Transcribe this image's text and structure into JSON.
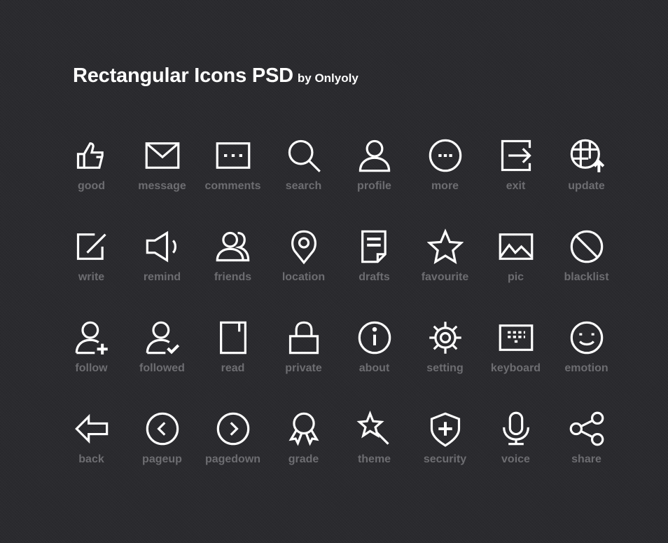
{
  "title": {
    "main": "Rectangular Icons PSD",
    "byline": "by Onlyoly"
  },
  "colors": {
    "background": "#2a2a2e",
    "icon": "#ffffff",
    "label": "#6d6d71",
    "title": "#ffffff"
  },
  "icons": [
    {
      "id": "good",
      "label": "good",
      "icon": "thumbs-up-icon"
    },
    {
      "id": "message",
      "label": "message",
      "icon": "envelope-icon"
    },
    {
      "id": "comments",
      "label": "comments",
      "icon": "comment-box-icon"
    },
    {
      "id": "search",
      "label": "search",
      "icon": "magnifier-icon"
    },
    {
      "id": "profile",
      "label": "profile",
      "icon": "user-icon"
    },
    {
      "id": "more",
      "label": "more",
      "icon": "ellipsis-circle-icon"
    },
    {
      "id": "exit",
      "label": "exit",
      "icon": "exit-arrow-icon"
    },
    {
      "id": "update",
      "label": "update",
      "icon": "globe-upload-icon"
    },
    {
      "id": "write",
      "label": "write",
      "icon": "edit-pencil-icon"
    },
    {
      "id": "remind",
      "label": "remind",
      "icon": "speaker-icon"
    },
    {
      "id": "friends",
      "label": "friends",
      "icon": "users-icon"
    },
    {
      "id": "location",
      "label": "location",
      "icon": "map-pin-icon"
    },
    {
      "id": "drafts",
      "label": "drafts",
      "icon": "document-icon"
    },
    {
      "id": "favourite",
      "label": "favourite",
      "icon": "star-icon"
    },
    {
      "id": "pic",
      "label": "pic",
      "icon": "image-icon"
    },
    {
      "id": "blacklist",
      "label": "blacklist",
      "icon": "block-icon"
    },
    {
      "id": "follow",
      "label": "follow",
      "icon": "user-add-icon"
    },
    {
      "id": "followed",
      "label": "followed",
      "icon": "user-check-icon"
    },
    {
      "id": "read",
      "label": "read",
      "icon": "book-icon"
    },
    {
      "id": "private",
      "label": "private",
      "icon": "lock-icon"
    },
    {
      "id": "about",
      "label": "about",
      "icon": "info-icon"
    },
    {
      "id": "setting",
      "label": "setting",
      "icon": "gear-icon"
    },
    {
      "id": "keyboard",
      "label": "keyboard",
      "icon": "keyboard-icon"
    },
    {
      "id": "emotion",
      "label": "emotion",
      "icon": "smiley-icon"
    },
    {
      "id": "back",
      "label": "back",
      "icon": "arrow-left-icon"
    },
    {
      "id": "pageup",
      "label": "pageup",
      "icon": "chevron-left-circle-icon"
    },
    {
      "id": "pagedown",
      "label": "pagedown",
      "icon": "chevron-right-circle-icon"
    },
    {
      "id": "grade",
      "label": "grade",
      "icon": "award-ribbon-icon"
    },
    {
      "id": "theme",
      "label": "theme",
      "icon": "magic-wand-icon"
    },
    {
      "id": "security",
      "label": "security",
      "icon": "shield-plus-icon"
    },
    {
      "id": "voice",
      "label": "voice",
      "icon": "microphone-icon"
    },
    {
      "id": "share",
      "label": "share",
      "icon": "share-nodes-icon"
    }
  ]
}
